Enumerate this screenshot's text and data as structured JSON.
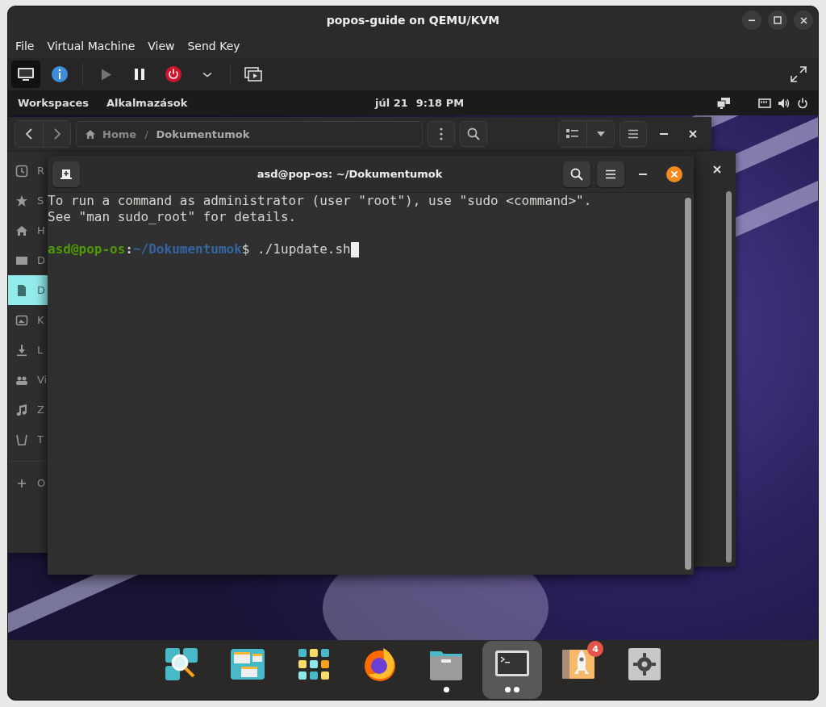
{
  "window": {
    "title": "popos-guide on QEMU/KVM"
  },
  "menu": [
    "File",
    "Virtual Machine",
    "View",
    "Send Key"
  ],
  "toolbar": [
    {
      "selected": true,
      "disabled": false
    },
    {
      "selected": false,
      "disabled": false
    },
    {
      "selected": false,
      "disabled": true
    },
    {
      "selected": false,
      "disabled": false
    },
    {
      "selected": false,
      "disabled": false
    },
    {
      "selected": false,
      "disabled": false
    },
    {
      "selected": false,
      "disabled": false
    }
  ],
  "guest_panel": {
    "workspaces": "Workspaces",
    "applications": "Alkalmazások",
    "date": "júl 21",
    "time": "9:18 PM"
  },
  "file_manager": {
    "breadcrumb": [
      "Home",
      "/",
      "Dokumentumok"
    ],
    "sidebar": [
      {
        "label": "R",
        "selected": false
      },
      {
        "label": "S",
        "selected": false
      },
      {
        "label": "H",
        "selected": false
      },
      {
        "label": "D",
        "selected": false
      },
      {
        "label": "D",
        "selected": true
      },
      {
        "label": "K",
        "selected": false
      },
      {
        "label": "L",
        "selected": false
      },
      {
        "label": "Vi",
        "selected": false
      },
      {
        "label": "Z",
        "selected": false
      },
      {
        "label": "T",
        "selected": false
      },
      {
        "label": "O",
        "selected": false
      }
    ]
  },
  "terminal": {
    "title": "asd@pop-os: ~/Dokumentumok",
    "lines": [
      "To run a command as administrator (user \"root\"), use \"sudo <command>\".",
      "See \"man sudo_root\" for details."
    ],
    "prompt": [
      {
        "text": "asd@pop-os",
        "color": "#4e9a06"
      },
      {
        "text": ":",
        "color": "#d3d7cf"
      },
      {
        "text": "~/Dokumentumok",
        "color": "#3465a4"
      },
      {
        "text": "$ ./1update.sh",
        "color": "#d3d7cf"
      }
    ]
  },
  "dock": [
    {
      "kind": "idle",
      "selected": false
    },
    {
      "kind": "idle",
      "selected": false
    },
    {
      "kind": "idle",
      "selected": false
    },
    {
      "kind": "idle",
      "selected": false
    },
    {
      "kind": "running",
      "selected": false
    },
    {
      "kind": "multiple",
      "selected": true
    },
    {
      "kind": "idle",
      "selected": false,
      "badge": "4"
    },
    {
      "kind": "idle",
      "selected": false
    }
  ]
}
